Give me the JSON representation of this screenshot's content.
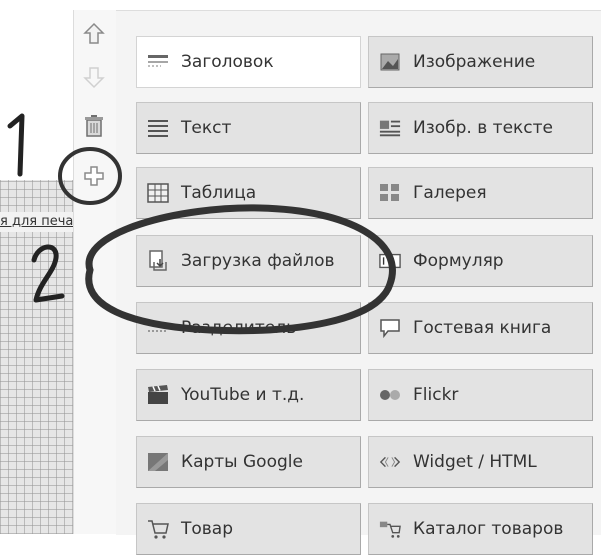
{
  "left_link": "я для печати",
  "toolbar": {
    "items": [
      {
        "name": "move-up",
        "icon": "arrow-up-icon"
      },
      {
        "name": "move-down",
        "icon": "arrow-down-icon"
      },
      {
        "name": "delete",
        "icon": "trash-icon"
      },
      {
        "name": "add",
        "icon": "plus-icon"
      }
    ]
  },
  "elements": [
    {
      "label": "Заголовок",
      "icon": "heading-icon"
    },
    {
      "label": "Изображение",
      "icon": "image-icon"
    },
    {
      "label": "Текст",
      "icon": "text-icon"
    },
    {
      "label": "Изобр. в тексте",
      "icon": "image-in-text-icon"
    },
    {
      "label": "Таблица",
      "icon": "table-icon"
    },
    {
      "label": "Галерея",
      "icon": "gallery-icon"
    },
    {
      "label": "Загрузка файлов",
      "icon": "file-upload-icon"
    },
    {
      "label": "Формуляр",
      "icon": "form-icon"
    },
    {
      "label": "Разделитель",
      "icon": "separator-icon"
    },
    {
      "label": "Гостевая книга",
      "icon": "guestbook-icon"
    },
    {
      "label": "YouTube и т.д.",
      "icon": "video-icon"
    },
    {
      "label": "Flickr",
      "icon": "flickr-icon"
    },
    {
      "label": "Карты Google",
      "icon": "map-icon"
    },
    {
      "label": "Widget / HTML",
      "icon": "code-icon"
    },
    {
      "label": "Товар",
      "icon": "product-icon"
    },
    {
      "label": "Каталог товаров",
      "icon": "catalog-icon"
    }
  ],
  "annotations": {
    "label_1": "1",
    "label_2": "2"
  }
}
